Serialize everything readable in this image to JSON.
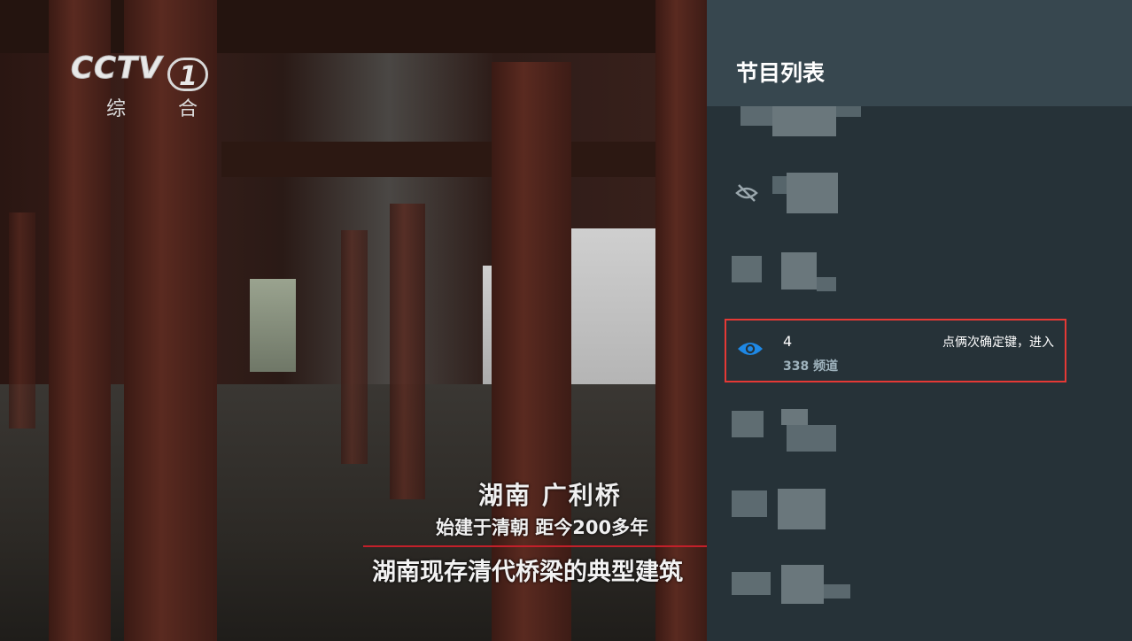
{
  "video": {
    "logo_brand": "CCTV",
    "logo_number": "1",
    "logo_channel": "综 合",
    "caption_title": "湖南  广利桥",
    "caption_sub": "始建于清朝  距今200多年",
    "caption_narration": "湖南现存清代桥梁的典型建筑"
  },
  "panel": {
    "title": "节目列表",
    "selected_item": {
      "name": "4",
      "channel_count": "338 频道",
      "hint": "点俩次确定键，进入",
      "icon": "eye-icon",
      "icon_color": "#1e88e5"
    },
    "other_items_icon": "eye-off-icon",
    "highlight_color": "#e53935"
  }
}
